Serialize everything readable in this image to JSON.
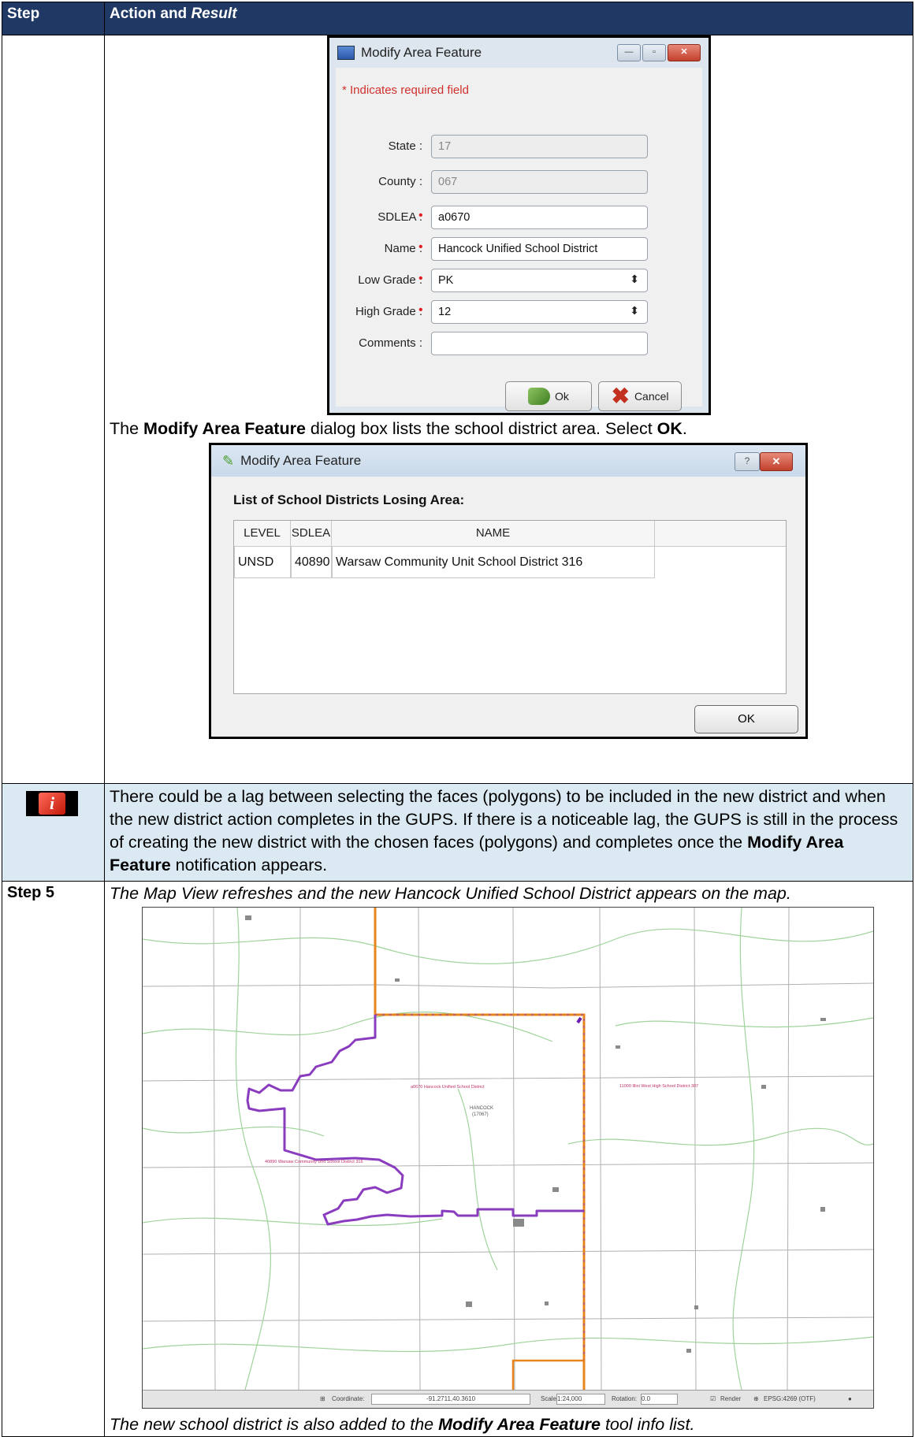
{
  "header": {
    "col1": "Step",
    "col2_plain": "Action and ",
    "col2_italic": "Result"
  },
  "dialog1": {
    "title": "Modify Area Feature",
    "required_note": "* Indicates required field",
    "fields": [
      {
        "label": "State :",
        "value": "17",
        "required": false,
        "disabled": true,
        "spinner": false
      },
      {
        "label": "County :",
        "value": "067",
        "required": false,
        "disabled": true,
        "spinner": false
      },
      {
        "label": "SDLEA :",
        "value": "a0670",
        "required": true,
        "disabled": false,
        "spinner": false
      },
      {
        "label": "Name :",
        "value": "Hancock Unified School District",
        "required": true,
        "disabled": false,
        "spinner": false
      },
      {
        "label": "Low Grade :",
        "value": "PK",
        "required": true,
        "disabled": false,
        "spinner": true
      },
      {
        "label": "High Grade :",
        "value": "12",
        "required": true,
        "disabled": false,
        "spinner": true
      },
      {
        "label": "Comments :",
        "value": "",
        "required": false,
        "disabled": false,
        "spinner": false
      }
    ],
    "ok_label": "Ok",
    "cancel_label": "Cancel"
  },
  "caption1": {
    "pre": "The ",
    "bold": "Modify Area Feature",
    "mid": " dialog box lists the school district area. Select ",
    "bold2": "OK",
    "post": "."
  },
  "dialog2": {
    "title": "Modify Area Feature",
    "help_label": "?",
    "close_label": "✕",
    "list_title": "List of School Districts Losing Area:",
    "columns": [
      "LEVEL",
      "SDLEA",
      "NAME"
    ],
    "rows": [
      [
        "UNSD",
        "40890",
        "Warsaw Community Unit School District 316"
      ]
    ],
    "ok_label": "OK"
  },
  "note": {
    "icon_label": "i",
    "pre": "There could be a lag between selecting the faces (polygons) to be included in the new district and when the new district action completes in the GUPS. If there is a noticeable lag, the GUPS is still in the process of creating the new district with the chosen faces (polygons) and completes once the ",
    "bold": "Modify Area Feature",
    "post": " notification appears."
  },
  "step5": {
    "label": "Step 5",
    "text": "The Map View refreshes and the new Hancock Unified School District appears on the map.",
    "footer_pre": "The new school district is also added to the ",
    "footer_bold": "Modify Area Feature",
    "footer_post": " tool info list."
  },
  "map": {
    "label_hancock": "a0670 Hancock Unified School District",
    "label_warsaw": "40890 Warsaw Community Unit School District 316",
    "label_east": "11000 Illini West High School District 307",
    "label_place": "HANCOCK",
    "label_place_code": "(17067)",
    "status": {
      "coordinate_label": "Coordinate:",
      "coordinate_value": "-91.2711,40.3610",
      "scale_label": "Scale",
      "scale_value": "1:24,000",
      "rotation_label": "Rotation:",
      "rotation_value": "0.0",
      "render_label": "Render",
      "crs_label": "EPSG:4269 (OTF)"
    },
    "colors": {
      "new_district": "#8a3cbf",
      "old_boundary": "#e8841c",
      "roads": "#9fd39a",
      "grid": "#b0b0b0"
    }
  }
}
